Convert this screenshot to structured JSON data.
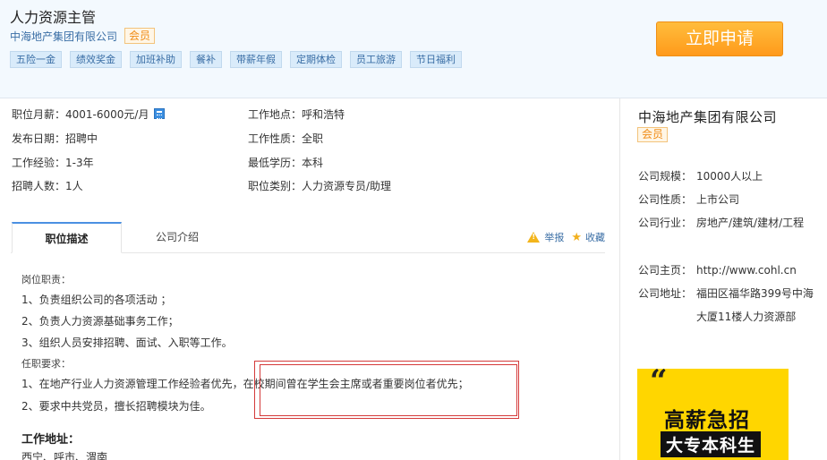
{
  "header": {
    "job_title": "人力资源主管",
    "company": "中海地产集团有限公司",
    "member_badge": "会员",
    "perks": [
      "五险一金",
      "绩效奖金",
      "加班补助",
      "餐补",
      "带薪年假",
      "定期体检",
      "员工旅游",
      "节日福利"
    ],
    "apply_label": "立即申请"
  },
  "info": {
    "salary_label": "职位月薪：",
    "salary_value": "4001-6000元/月",
    "location_label": "工作地点：",
    "location_value": "呼和浩特",
    "publish_label": "发布日期：",
    "publish_value": "招聘中",
    "nature_label": "工作性质：",
    "nature_value": "全职",
    "experience_label": "工作经验：",
    "experience_value": "1-3年",
    "education_label": "最低学历：",
    "education_value": "本科",
    "headcount_label": "招聘人数：",
    "headcount_value": "1人",
    "category_label": "职位类别：",
    "category_value": "人力资源专员/助理"
  },
  "tabs": {
    "description": "职位描述",
    "company_intro": "公司介绍",
    "report": "举报",
    "favorite": "收藏"
  },
  "description": {
    "duties_heading": "岗位职责：",
    "duties": [
      "1、负责组织公司的各项活动 ；",
      "2、负责人力资源基础事务工作；",
      "3、组织人员安排招聘、面试、入职等工作。"
    ],
    "requirements_heading": "任职要求：",
    "requirements": [
      "1、在地产行业人力资源管理工作经验者优先，在校期间曾在学生会主席或者重要岗位者优先；",
      "2、要求中共党员，擅长招聘模块为佳。"
    ],
    "address_heading": "工作地址：",
    "address_value": "西宁、呼市、渭南"
  },
  "sidebar": {
    "company_name": "中海地产集团有限公司",
    "member_badge": "会员",
    "size_label": "公司规模：",
    "size_value": "10000人以上",
    "type_label": "公司性质：",
    "type_value": "上市公司",
    "industry_label": "公司行业：",
    "industry_value": "房地产/建筑/建材/工程",
    "homepage_label": "公司主页：",
    "homepage_value": "http://www.cohl.cn",
    "address_label": "公司地址：",
    "address_value": "福田区福华路399号中海大厦11楼人力资源部"
  },
  "ad": {
    "quote": "“",
    "line1": "高薪急招",
    "line2": "大专本科生"
  },
  "colors": {
    "accent_blue": "#4a90e2",
    "link_blue": "#3a6ea5",
    "apply_orange": "#ff9a1b",
    "highlight_red": "#d43a3a",
    "ad_yellow": "#ffd600"
  }
}
